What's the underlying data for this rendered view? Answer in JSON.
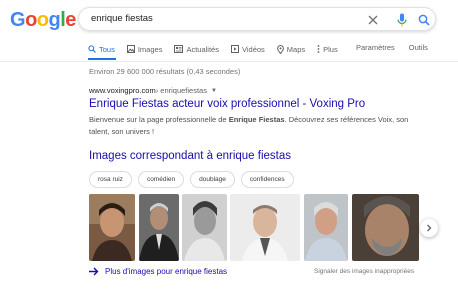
{
  "logo": {
    "letters": [
      "G",
      "o",
      "o",
      "g",
      "l",
      "e"
    ],
    "colors": [
      "#4285f4",
      "#ea4335",
      "#fbbc05",
      "#4285f4",
      "#34a853",
      "#ea4335"
    ]
  },
  "search": {
    "query": "enrique fiestas"
  },
  "tabs": [
    {
      "label": "Tous",
      "icon": "search-icon",
      "active": true
    },
    {
      "label": "Images",
      "icon": "image-icon"
    },
    {
      "label": "Actualités",
      "icon": "news-icon"
    },
    {
      "label": "Vidéos",
      "icon": "video-icon"
    },
    {
      "label": "Maps",
      "icon": "map-pin-icon"
    },
    {
      "label": "Plus",
      "icon": "more-vert-icon"
    }
  ],
  "tools": {
    "settings": "Paramètres",
    "tools": "Outils"
  },
  "stats": "Environ 29 600 000 résultats (0,43 secondes)",
  "result": {
    "domain": "www.voxingpro.com",
    "breadcrumb": " › enriquefiestas",
    "title": "Enrique Fiestas acteur voix professionnel - Voxing Pro",
    "snippet_pre": "Bienvenue sur la page professionnelle de ",
    "snippet_bold": "Enrique Fiestas",
    "snippet_post": ". Découvrez ses références Voix, son talent, son univers !"
  },
  "images": {
    "heading": "Images correspondant à enrique fiestas",
    "chips": [
      "rosa ruiz",
      "comédien",
      "doublage",
      "confidences"
    ],
    "more_label": "Plus d'images pour enrique fiestas",
    "report_label": "Signaler des images inappropriées"
  },
  "colors": {
    "accent": "#1a73e8",
    "link": "#1a0dab"
  }
}
